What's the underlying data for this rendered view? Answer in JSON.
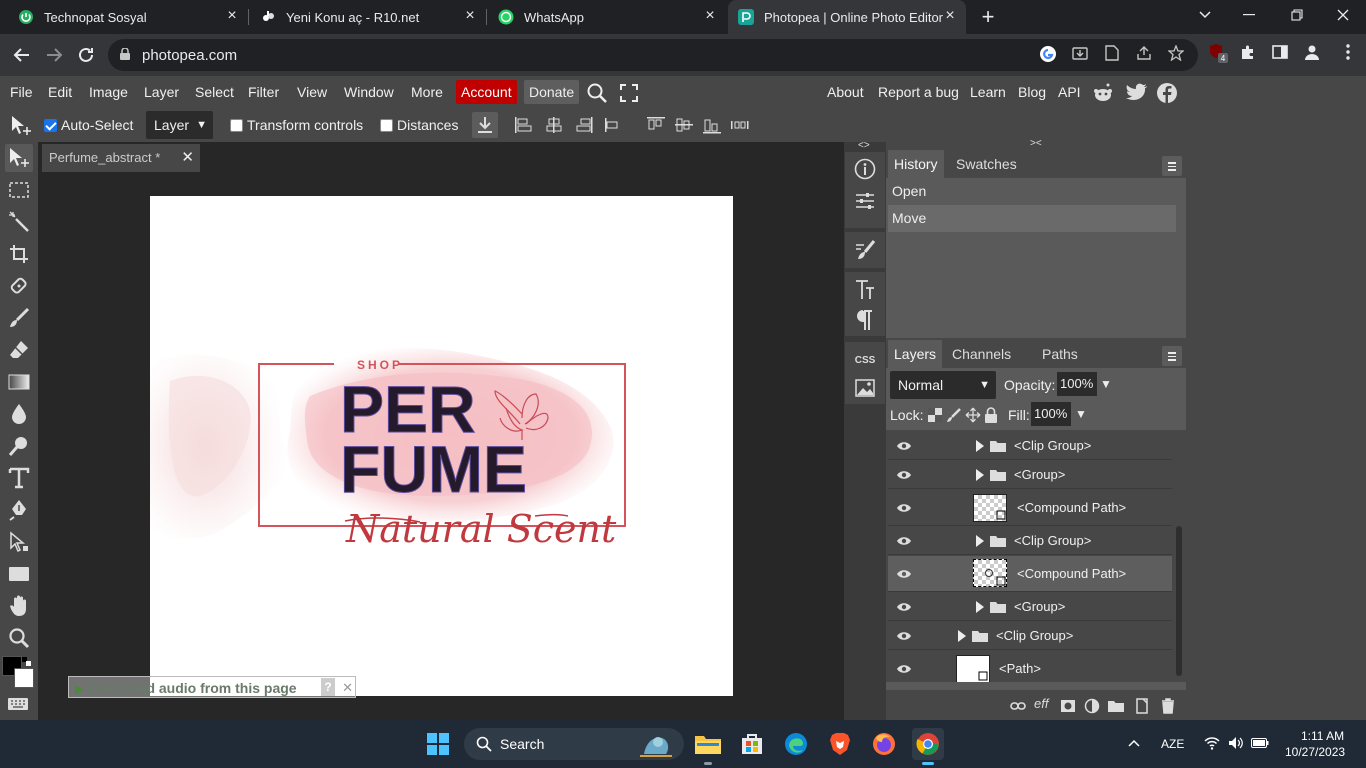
{
  "browser": {
    "tabs": [
      {
        "title": "Technopat Sosyal",
        "icon": "technopat-icon",
        "color": "#27ae60"
      },
      {
        "title": "Yeni Konu aç - R10.net",
        "icon": "r10-icon",
        "color": "#ffffff"
      },
      {
        "title": "WhatsApp",
        "icon": "whatsapp-icon",
        "color": "#25d366"
      },
      {
        "title": "Photopea | Online Photo Editor",
        "icon": "photopea-icon",
        "color": "#18a497"
      }
    ],
    "active_tab": 3,
    "url": "photopea.com",
    "extension_badge": "4"
  },
  "menu": {
    "items": [
      "File",
      "Edit",
      "Image",
      "Layer",
      "Select",
      "Filter",
      "View",
      "Window",
      "More"
    ],
    "account": "Account",
    "donate": "Donate",
    "right": [
      "About",
      "Report a bug",
      "Learn",
      "Blog",
      "API"
    ],
    "account_color": "#c00000"
  },
  "options": {
    "auto_select_label": "Auto-Select",
    "auto_select_checked": true,
    "auto_select_target": "Layer",
    "transform_controls_label": "Transform controls",
    "distances_label": "Distances"
  },
  "document": {
    "tab_title": "Perfume_abstract *",
    "artwork": {
      "shop": "SHOP",
      "line1": "PER",
      "line2": "FUME",
      "script": "Natural Scent"
    },
    "overlay_bar": "Download audio from this page",
    "overlay_help": "?"
  },
  "history": {
    "tabs": [
      "History",
      "Swatches"
    ],
    "items": [
      "Open",
      "Move"
    ]
  },
  "layers": {
    "tabs": [
      "Layers",
      "Channels",
      "Paths"
    ],
    "blend_mode": "Normal",
    "opacity_label": "Opacity:",
    "opacity": "100%",
    "lock_label": "Lock:",
    "fill_label": "Fill:",
    "fill": "100%",
    "rows": [
      {
        "name": "<Clip Group>",
        "kind": "folder"
      },
      {
        "name": "<Group>",
        "kind": "folder"
      },
      {
        "name": "<Compound Path>",
        "kind": "thumb"
      },
      {
        "name": "<Clip Group>",
        "kind": "folder"
      },
      {
        "name": "<Compound Path>",
        "kind": "thumb",
        "selected": true
      },
      {
        "name": "<Group>",
        "kind": "folder"
      },
      {
        "name": "<Clip Group>",
        "kind": "folder"
      },
      {
        "name": "<Path>",
        "kind": "thumb-white"
      }
    ]
  },
  "taskbar": {
    "search_label": "Search",
    "language": "AZE",
    "time": "1:11 AM",
    "date": "10/27/2023"
  }
}
